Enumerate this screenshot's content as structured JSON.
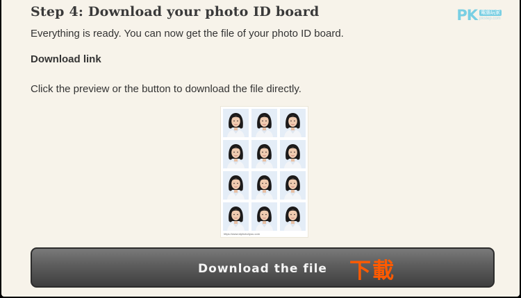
{
  "page": {
    "step_title": "Step 4: Download your photo ID board",
    "intro_text": "Everything is ready. You can now get the file of your photo ID board.",
    "section_label": "Download link",
    "instruction_text": "Click the preview or the button to download the file directly."
  },
  "watermark": {
    "letters": "PK",
    "tag": "電腦玩家",
    "sub": "pkstep.com"
  },
  "preview": {
    "rows": 4,
    "columns": 3,
    "url_caption": "https://www.idphoto4you.com"
  },
  "download": {
    "button_label": "Download the file",
    "annotation": "下載"
  },
  "colors": {
    "background": "#f7f3ea",
    "button": "#5c5c5c",
    "annotation": "#ff5a00",
    "watermark": "#79cfe3"
  }
}
